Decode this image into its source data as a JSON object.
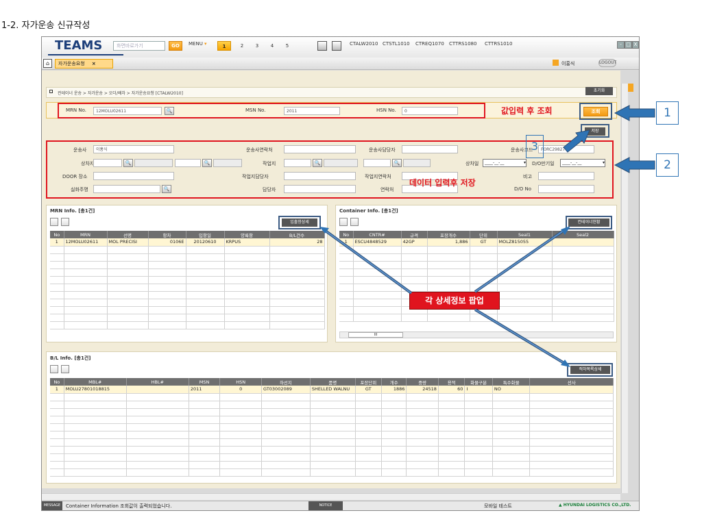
{
  "doc_title": "1-2. 자가운송 신규작성",
  "app": {
    "logo": "TEAMS",
    "menu_search_placeholder": "화면바로가기",
    "go_label": "GO",
    "menu_label": "MENU",
    "page_tabs": [
      "1",
      "2",
      "3",
      "4",
      "5"
    ],
    "quick_tabs": [
      "CTALW2010",
      "CTSTL1010",
      "CTREQ1070",
      "CTTRS1080",
      "CTTRS1010"
    ],
    "window_buttons": [
      "-",
      "□",
      "X"
    ]
  },
  "nav": {
    "home_icon": "home-icon",
    "active_tab": "자가운송요청",
    "tab_close": "×",
    "user": "이홍식",
    "logout": "LOGOUT"
  },
  "breadcrumb": "컨테이너 운송 > 자가운송 > 오더/배차 > 자가운송요청 [CTALW2010]",
  "reset_label": "초기화",
  "search": {
    "mrn_label": "MRN No.",
    "mrn_value": "12MOLU02611",
    "msn_label": "MSN No.",
    "msn_value": "2011",
    "hsn_label": "HSN No.",
    "hsn_value": "0",
    "query_label": "조회",
    "save_label": "저장"
  },
  "form": {
    "carrier_label": "운송사",
    "carrier_value": "이홍식",
    "carrier_contact_label": "운송사연락처",
    "carrier_manager_label": "운송사담당자",
    "carrier_code_label": "운송사코드",
    "carrier_code_value": "FORC29827",
    "load_place_label": "상차지",
    "work_place_label": "작업지",
    "load_date_label": "상차일",
    "do_expiry_label": "D/O만기일",
    "date_placeholder": "____-__-__",
    "door_label": "DOOR 장소",
    "work_manager_label": "작업지담당자",
    "work_contact_label": "작업지연락처",
    "remark_label": "비고",
    "shipper_label": "실화주명",
    "person_label": "담당자",
    "phone_label": "연락처",
    "do_no_label": "D/O No"
  },
  "mrn_panel": {
    "title": "MRN Info. [총1건]",
    "detail_button": "입출항상세",
    "headers": [
      "No",
      "MRN",
      "선명",
      "항차",
      "입항일",
      "양륙항",
      "B/L건수"
    ],
    "rows": [
      [
        "1",
        "12MOLU02611",
        "MOL PRECISI",
        "0106E",
        "20120610",
        "KRPUS",
        "28"
      ]
    ]
  },
  "container_panel": {
    "title": "Container Info. [총1건]",
    "detail_button": "컨테이너현황",
    "headers": [
      "No",
      "CNTR#",
      "규격",
      "포장개수",
      "단위",
      "Seal1",
      "Seal2"
    ],
    "rows": [
      [
        "1",
        "ESCU4848529",
        "42GP",
        "1,886",
        "GT",
        "MOLZ815055",
        ""
      ]
    ],
    "scroll_label": "III"
  },
  "bl_panel": {
    "title": "B/L Info. [총1건]",
    "detail_button": "적하목록상세",
    "headers": [
      "No",
      "MBL#",
      "HBL#",
      "MSN",
      "HSN",
      "하선지",
      "품명",
      "포장단위",
      "개수",
      "중량",
      "용적",
      "화물구분",
      "특수화물",
      "선사"
    ],
    "rows": [
      [
        "1",
        "MOLU27801018815",
        "",
        "2011",
        "0",
        "GT03002089",
        "SHELLED WALNU",
        "GT",
        "1886",
        "24518",
        "60",
        "I",
        "NO",
        ""
      ]
    ]
  },
  "status": {
    "message_tag": "MESSAGE",
    "message": "Container Information 조회값이 출력되었습니다.",
    "notice_tag": "NOTICE",
    "mobile": "모바일 테스트",
    "company": "▲ HYUNDAI LOGISTICS CO.,LTD."
  },
  "annotations": {
    "search_note": "값입력 후 조회",
    "form_note": "데이터 입력후 저장",
    "popup_note": "각 상세정보 팝업",
    "step1": "1",
    "step2": "2",
    "step3": "3"
  },
  "colors": {
    "accent_orange": "#f39a12",
    "annotation_red": "#e0141e",
    "callout_blue": "#2f74b5",
    "header_gray": "#6f6f6f",
    "content_bg": "#f2ecd8"
  }
}
